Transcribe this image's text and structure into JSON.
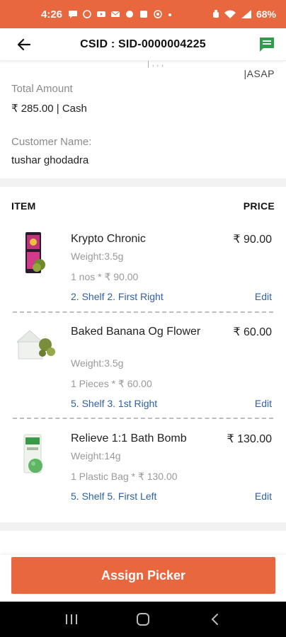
{
  "status_bar": {
    "time": "4:26",
    "battery": "68%"
  },
  "app_bar": {
    "title": "CSID : SID-0000004225"
  },
  "order": {
    "partial_text": "| , , ,",
    "asap": "|ASAP",
    "total_amount_label": "Total Amount",
    "total_amount_value": "₹ 285.00 | Cash",
    "customer_name_label": "Customer Name:",
    "customer_name_value": "tushar ghodadra"
  },
  "table": {
    "item_header": "ITEM",
    "price_header": "PRICE"
  },
  "items": [
    {
      "name": "Krypto Chronic",
      "price": "₹ 90.00",
      "weight": "Weight:3.5g",
      "qty": "1 nos * ₹ 90.00",
      "shelf": "2. Shelf 2. First Right",
      "edit": "Edit"
    },
    {
      "name": "Baked Banana Og Flower",
      "price": "₹ 60.00",
      "weight": "Weight:3.5g",
      "qty": "1 Pieces * ₹ 60.00",
      "shelf": "5. Shelf 3. 1st Right",
      "edit": "Edit"
    },
    {
      "name": "Relieve 1:1 Bath Bomb",
      "price": "₹ 130.00",
      "weight": "Weight:14g",
      "qty": "1 Plastic Bag * ₹ 130.00",
      "shelf": "5. Shelf 5. First Left",
      "edit": "Edit"
    }
  ],
  "footer": {
    "assign_label": "Assign Picker"
  },
  "colors": {
    "accent": "#e9673f",
    "link": "#2f5fa8",
    "chat_icon": "#2e9e4a"
  },
  "icons": [
    "back-arrow-icon",
    "chat-icon",
    "recents-icon",
    "home-icon",
    "back-nav-icon"
  ]
}
